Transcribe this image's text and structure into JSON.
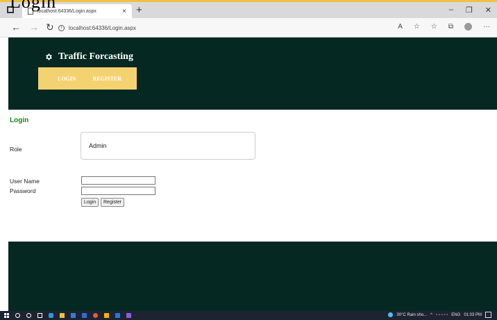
{
  "page_fragment_text": "Login",
  "browser": {
    "tab_title": "localhost:64336/Login.aspx",
    "tab_close": "×",
    "new_tab": "+",
    "url": "localhost:64336/Login.aspx",
    "window_controls": [
      "–",
      "❐",
      "✕"
    ]
  },
  "header": {
    "brand_title": "Traffic Forcasting",
    "nav": [
      {
        "label": "LOGIN"
      },
      {
        "label": "REGISTER"
      }
    ],
    "background": "#062822",
    "nav_background": "#f4d270"
  },
  "form": {
    "title": "Login",
    "role_label": "Role",
    "role_value": "Admin",
    "username_label": "User Name",
    "password_label": "Password",
    "username_value": "",
    "password_value": "",
    "login_button": "Login",
    "register_button": "Register"
  },
  "taskbar": {
    "weather": "30°C  Rain sho...",
    "language": "ENG",
    "time": "01:03 PM"
  }
}
